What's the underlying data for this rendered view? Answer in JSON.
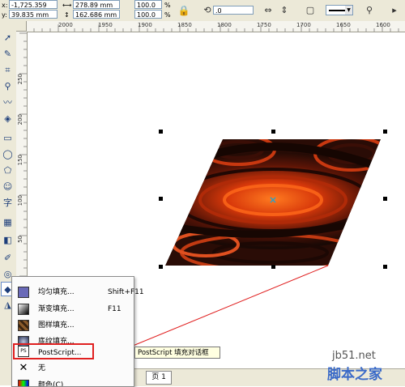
{
  "propbar": {
    "x_label": "x:",
    "x_value": "-1,725.359 mm",
    "y_label": "y:",
    "y_value": "39.835 mm",
    "w_value": "278.89 mm",
    "h_value": "162.686 mm",
    "scale_x": "100.0",
    "scale_y": "100.0",
    "pct": "%",
    "rotation": ".0"
  },
  "ruler": {
    "h_ticks": [
      "2000",
      "1950",
      "1900",
      "1850",
      "1800",
      "1750",
      "1700",
      "1650",
      "1600"
    ],
    "v_ticks": [
      "250",
      "200",
      "150",
      "100",
      "50"
    ]
  },
  "toolbox": {
    "icons": [
      "pick-tool-icon",
      "shape-tool-icon",
      "crop-tool-icon",
      "zoom-tool-icon",
      "freehand-tool-icon",
      "smart-fill-icon",
      "rectangle-tool-icon",
      "ellipse-tool-icon",
      "polygon-tool-icon",
      "basic-shapes-icon",
      "text-tool-icon",
      "table-tool-icon",
      "interactive-blend-icon",
      "eyedropper-icon",
      "outline-tool-icon",
      "fill-tool-icon",
      "interactive-fill-icon"
    ],
    "text_tool_glyph": "字"
  },
  "fill_menu": {
    "items": [
      {
        "label": "均匀填充...",
        "shortcut": "Shift+F11",
        "icon": "uniform-fill-icon"
      },
      {
        "label": "渐变填充...",
        "shortcut": "F11",
        "icon": "fountain-fill-icon"
      },
      {
        "label": "图样填充...",
        "shortcut": "",
        "icon": "pattern-fill-icon"
      },
      {
        "label": "底纹填充...",
        "shortcut": "",
        "icon": "texture-fill-icon"
      },
      {
        "label": "PostScript...",
        "shortcut": "",
        "icon": "postscript-fill-icon"
      },
      {
        "label": "无",
        "shortcut": "",
        "icon": "no-fill-icon"
      },
      {
        "label": "颜色(C)",
        "shortcut": "",
        "icon": "color-docker-icon"
      }
    ],
    "ps_icon_text": "PS"
  },
  "tooltip": "PostScript 填充对话框",
  "page_tab": "页 1",
  "colors": {
    "fill_dark": "#1a0905",
    "fill_orange": "#e8480f",
    "highlight": "#e02020",
    "center_marker": "#2aa0c8"
  },
  "watermark": {
    "site": "jb51.net",
    "brand": "脚本之家"
  }
}
